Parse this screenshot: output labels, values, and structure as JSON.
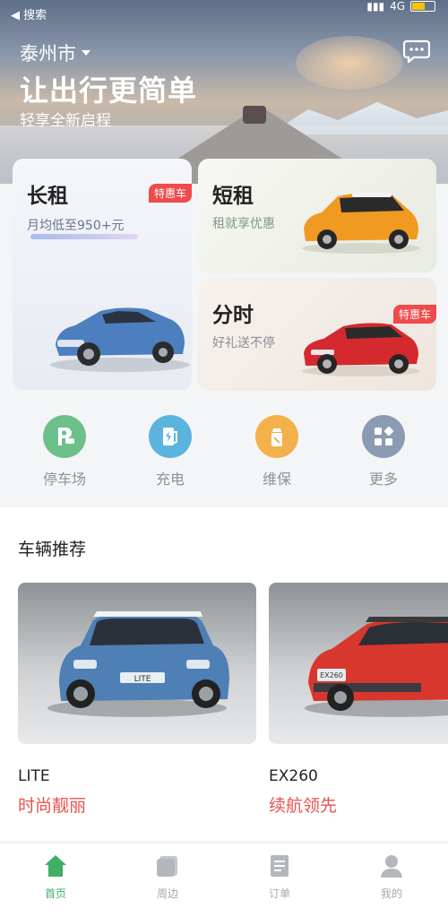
{
  "status_bar": {
    "back_label": "◀ 搜索",
    "network": "4G"
  },
  "header": {
    "city": "泰州市",
    "slogan": "让出行更简单",
    "subtitle": "轻享全新启程"
  },
  "cards": {
    "long": {
      "title": "长租",
      "subtitle": "月均低至950+元",
      "tag": "特惠车"
    },
    "short": {
      "title": "短租",
      "subtitle": "租就享优惠"
    },
    "hourly": {
      "title": "分时",
      "subtitle": "好礼送不停",
      "tag": "特惠车"
    }
  },
  "services": [
    {
      "label": "停车场",
      "icon": "parking-icon",
      "color": "#6cc08a"
    },
    {
      "label": "充电",
      "icon": "charging-icon",
      "color": "#5bb4dd"
    },
    {
      "label": "维保",
      "icon": "maintenance-icon",
      "color": "#f3b14b"
    },
    {
      "label": "更多",
      "icon": "more-grid-icon",
      "color": "#8d9ab4"
    }
  ],
  "recommend": {
    "title": "车辆推荐",
    "vehicles": [
      {
        "name": "LITE",
        "slogan": "时尚靓丽",
        "plate": "LITE"
      },
      {
        "name": "EX260",
        "slogan": "续航领先",
        "plate": "EX260"
      }
    ]
  },
  "tabbar": [
    {
      "label": "首页",
      "icon": "home-icon",
      "active": true
    },
    {
      "label": "周边",
      "icon": "nearby-icon",
      "active": false
    },
    {
      "label": "订单",
      "icon": "order-icon",
      "active": false
    },
    {
      "label": "我的",
      "icon": "profile-icon",
      "active": false
    }
  ],
  "colors": {
    "accent_green": "#3fae66",
    "tag_red": "#ef4b4b",
    "slogan_red": "#e8524f"
  }
}
